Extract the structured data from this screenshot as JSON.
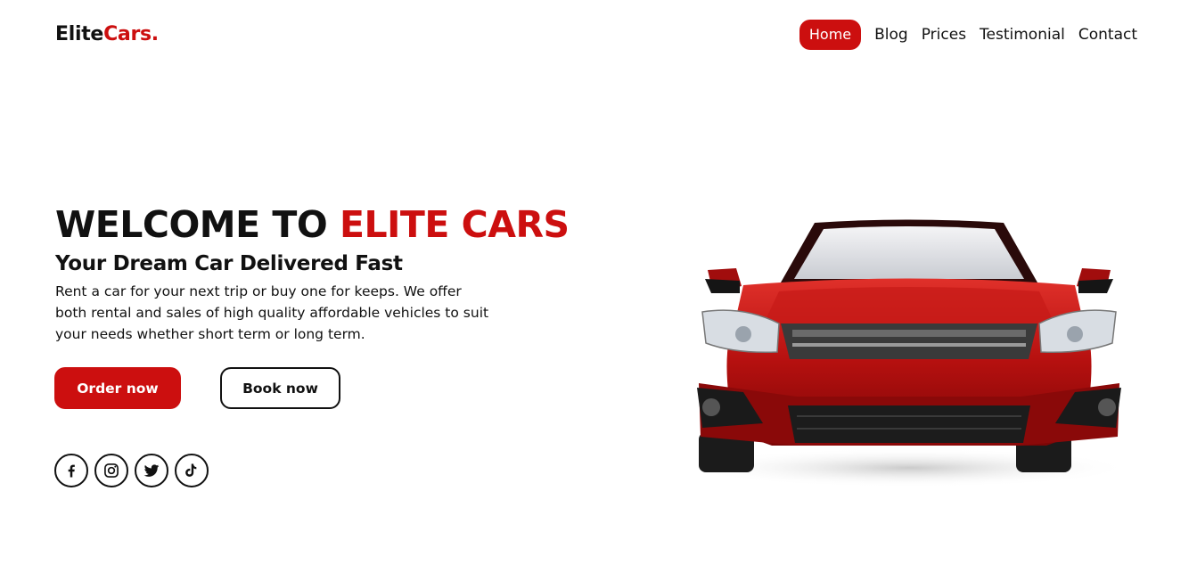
{
  "brand": {
    "name": "Elite",
    "accent": "Cars."
  },
  "nav": {
    "items": [
      {
        "label": "Home",
        "active": true
      },
      {
        "label": "Blog"
      },
      {
        "label": "Prices"
      },
      {
        "label": "Testimonial"
      },
      {
        "label": "Contact"
      }
    ]
  },
  "hero": {
    "title_main": "WELCOME TO ",
    "title_accent": "ELITE CARS",
    "subtitle": "Your Dream Car Delivered Fast",
    "description": "Rent a car for your next trip or buy one for keeps. We offer both rental and sales of high quality affordable vehicles to suit your needs whether short term or long term.",
    "order_label": "Order now",
    "book_label": "Book now"
  },
  "socials": [
    "facebook-icon",
    "instagram-icon",
    "twitter-icon",
    "tiktok-icon"
  ],
  "colors": {
    "accent": "#cc0f0f",
    "text": "#111111",
    "background": "#ffffff"
  },
  "hero_image": "red-sedan-car-front-view"
}
